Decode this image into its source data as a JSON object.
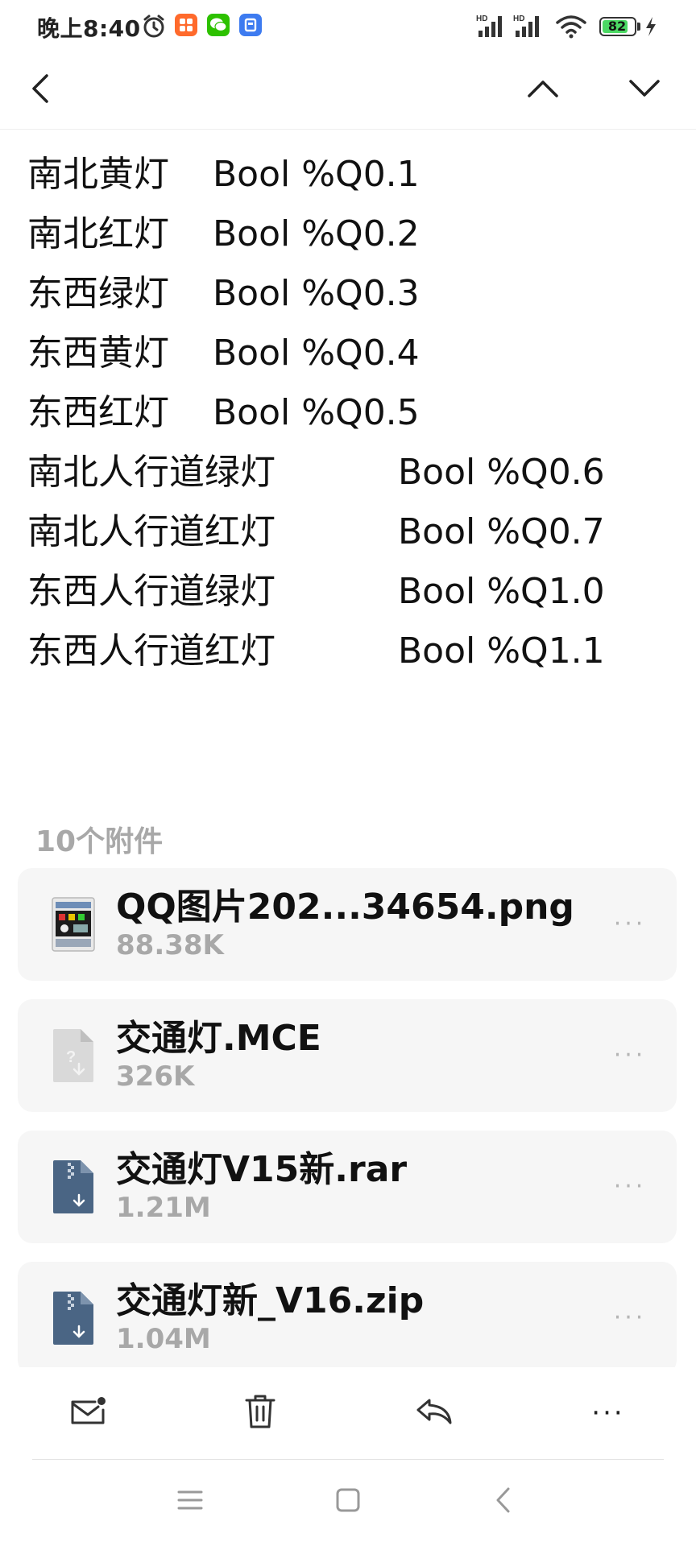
{
  "status_bar": {
    "time": "晚上8:40",
    "battery_level": "82",
    "battery_fraction": 0.82,
    "app_icons": [
      "alarm-icon",
      "taobao-app-icon",
      "wechat-app-icon",
      "blue-app-icon"
    ],
    "system_icons": [
      "hd-signal-1-icon",
      "hd-signal-2-icon",
      "wifi-icon",
      "battery-icon",
      "charging-icon"
    ],
    "signal_label": "HD"
  },
  "nav": {
    "back_icon": "chevron-left-icon",
    "prev_icon": "chevron-up-icon",
    "next_icon": "chevron-down-icon"
  },
  "variables": [
    {
      "name": "南北黄灯",
      "type": "Bool",
      "address": "%Q0.1"
    },
    {
      "name": "南北红灯",
      "type": "Bool",
      "address": "%Q0.2"
    },
    {
      "name": "东西绿灯",
      "type": "Bool",
      "address": "%Q0.3"
    },
    {
      "name": "东西黄灯",
      "type": "Bool",
      "address": "%Q0.4"
    },
    {
      "name": "东西红灯",
      "type": "Bool",
      "address": "%Q0.5"
    },
    {
      "name": "南北人行道绿灯",
      "type": "Bool",
      "address": "%Q0.6"
    },
    {
      "name": "南北人行道红灯",
      "type": "Bool",
      "address": "%Q0.7"
    },
    {
      "name": "东西人行道绿灯",
      "type": "Bool",
      "address": "%Q1.0"
    },
    {
      "name": "东西人行道红灯",
      "type": "Bool",
      "address": "%Q1.1"
    }
  ],
  "attachments": {
    "heading": "10个附件",
    "items": [
      {
        "name": "QQ图片202...34654.png",
        "size": "88.38K",
        "icon": "image-thumbnail-icon"
      },
      {
        "name": "交通灯.MCE",
        "size": "326K",
        "icon": "unknown-file-icon"
      },
      {
        "name": "交通灯V15新.rar",
        "size": "1.21M",
        "icon": "archive-file-icon"
      },
      {
        "name": "交通灯新_V16.zip",
        "size": "1.04M",
        "icon": "archive-file-icon"
      }
    ],
    "more_label": "···"
  },
  "toolbar": {
    "items": [
      "mark-unread-icon",
      "delete-icon",
      "reply-icon",
      "more-icon"
    ],
    "more_label": "···"
  },
  "system_nav": {
    "items": [
      "menu-icon",
      "home-icon",
      "back-icon"
    ]
  },
  "colors": {
    "text": "#111111",
    "muted": "#a8a8a8",
    "card": "#f6f6f6",
    "battery": "#4cd964",
    "archive_icon": "#4a6584"
  }
}
